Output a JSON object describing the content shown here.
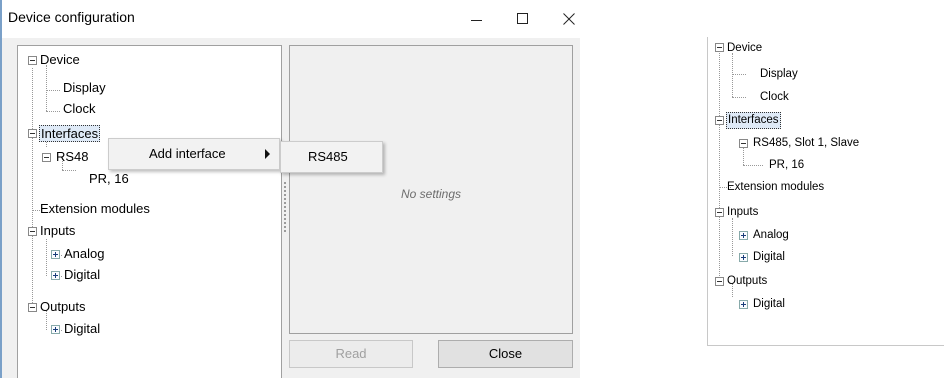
{
  "window": {
    "title": "Device configuration",
    "controls": {
      "minimize": "minimize-icon",
      "maximize": "maximize-icon",
      "close": "close-icon"
    }
  },
  "tree": {
    "device": "Device",
    "display": "Display",
    "clock": "Clock",
    "interfaces": "Interfaces",
    "rs485_partial": "RS48",
    "pr": "PR, 16",
    "extension": "Extension modules",
    "inputs": "Inputs",
    "analog": "Analog",
    "digital_in": "Digital",
    "outputs": "Outputs",
    "digital_out": "Digital"
  },
  "context_menu": {
    "item": "Add interface"
  },
  "submenu": {
    "item": "RS485"
  },
  "settings": {
    "placeholder": "No settings"
  },
  "buttons": {
    "read": "Read",
    "close": "Close"
  },
  "right_tree": {
    "device": "Device",
    "display": "Display",
    "clock": "Clock",
    "interfaces": "Interfaces",
    "rs485": "RS485, Slot 1, Slave",
    "pr": "PR, 16",
    "extension": "Extension modules",
    "inputs": "Inputs",
    "analog": "Analog",
    "digital_in": "Digital",
    "outputs": "Outputs",
    "digital_out": "Digital"
  },
  "colors": {
    "selection_bg": "#dfeaf7",
    "window_bg": "#f0f0f0",
    "accent_border": "#7aa0c8"
  }
}
